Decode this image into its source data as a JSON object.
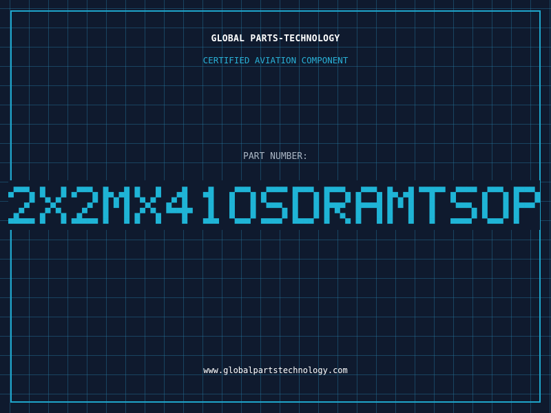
{
  "header": {
    "company": "GLOBAL PARTS-TECHNOLOGY",
    "tagline": "CERTIFIED AVIATION COMPONENT"
  },
  "part": {
    "label": "PART NUMBER:",
    "number": "2X2MX41OSDRAMTSOP"
  },
  "footer": {
    "url": "www.globalpartstechnology.com"
  },
  "colors": {
    "background": "#0f1a2e",
    "grid": "#26789f",
    "frame": "#1fa6cc",
    "accent": "#1fb4d6",
    "title": "#ffffff",
    "label": "#aab6c4"
  }
}
